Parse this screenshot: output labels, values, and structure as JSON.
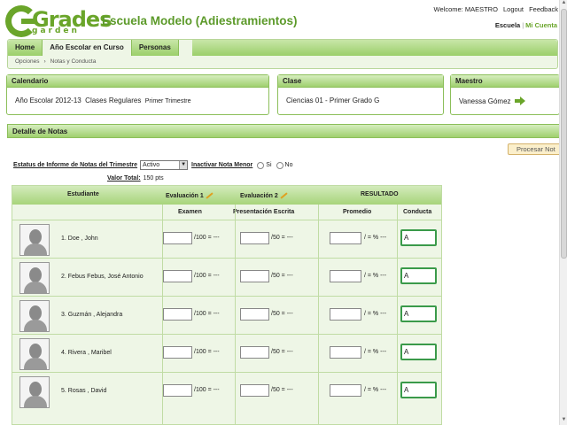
{
  "app": {
    "logo_top": "Grades",
    "logo_bottom": "garden",
    "school_title": "Escuela Modelo (Adiestramientos)"
  },
  "topbar": {
    "welcome": "Welcome: MAESTRO",
    "logout": "Logout",
    "feedback": "Feedback",
    "escuela": "Escuela",
    "separator": "|",
    "mi_cuenta": "Mi Cuenta"
  },
  "tabs": [
    {
      "label": "Home"
    },
    {
      "label": "Año Escolar en Curso"
    },
    {
      "label": "Personas"
    }
  ],
  "breadcrumb": [
    "Opciones",
    "›",
    "Notas y Conducta"
  ],
  "calendario": {
    "header": "Calendario",
    "year": "Año Escolar 2012-13",
    "type": "Clases Regulares",
    "term": "Primer Trimestre"
  },
  "clase": {
    "header": "Clase",
    "value": "Ciencias 01 -  Primer Grado  G"
  },
  "maestro": {
    "header": "Maestro",
    "name": "Vanessa Gómez"
  },
  "detalle": {
    "header": "Detalle de Notas",
    "procesar": "Procesar Not",
    "estatus_label": "Estatus de Informe de Notas del Trimestre",
    "estatus_value": "Activo",
    "inactivar_label": "Inactivar Nota Menor",
    "si": "Si",
    "no": "No",
    "valor_label": "Valor Total:",
    "valor_value": "150 pts"
  },
  "table": {
    "h_estudiante": "Estudiante",
    "h_eval1": "Evaluación 1",
    "h_eval2": "Evaluación 2",
    "h_resultado": "RESULTADO",
    "h_examen": "Examen",
    "h_presentacion": "Presentación Escrita",
    "h_promedio": "Promedio",
    "h_conducta": "Conducta",
    "suffix1": "/100 = ---",
    "suffix2": "/50 = ---",
    "suffix3": "/ = % ---",
    "rows": [
      {
        "name": "1. Doe , John",
        "conducta": "A"
      },
      {
        "name": "2. Febus Febus, José Antonio",
        "conducta": "A"
      },
      {
        "name": "3. Guzmán , Alejandra",
        "conducta": "A"
      },
      {
        "name": "4. Rivera , Maribel",
        "conducta": "A"
      },
      {
        "name": "5. Rosas , David",
        "conducta": "A"
      }
    ]
  },
  "colors": {
    "accent": "#6aa52a",
    "header_green": "#9fd06e",
    "conducta_border": "#3a9a4a"
  }
}
